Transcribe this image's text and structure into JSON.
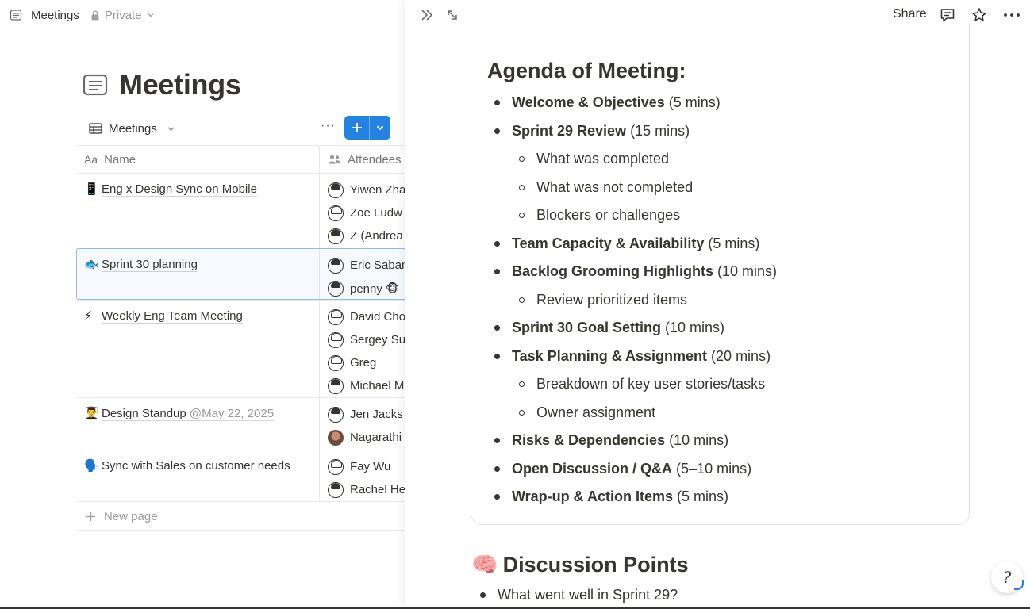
{
  "breadcrumb": {
    "page": "Meetings",
    "privacy": "Private"
  },
  "page": {
    "title": "Meetings"
  },
  "view": {
    "name": "Meetings"
  },
  "table": {
    "columns": [
      "Name",
      "Attendees"
    ],
    "column_icons": [
      "Aa",
      "people-icon"
    ],
    "rows": [
      {
        "emoji": "📱",
        "title": "Eng x Design Sync on Mobile",
        "date": "",
        "attendees": [
          "Yiwen Zha",
          "Zoe Ludw",
          "Z (Andrea"
        ]
      },
      {
        "emoji": "🐟",
        "title": "Sprint 30 planning",
        "date": "",
        "attendees": [
          "Eric Saban",
          "penny 🐵"
        ]
      },
      {
        "emoji": "⚡",
        "title": "Weekly Eng Team Meeting",
        "date": "",
        "attendees": [
          "David Cho",
          "Sergey Su",
          "Greg",
          "Michael M"
        ]
      },
      {
        "emoji": "👨‍🎓",
        "title": "Design Standup",
        "date": "@May 22, 2025",
        "attendees": [
          "Jen Jacks",
          "Nagarathi"
        ]
      },
      {
        "emoji": "🗣️",
        "title": "Sync with Sales on customer needs",
        "date": "",
        "attendees": [
          "Fay Wu",
          "Rachel He"
        ]
      }
    ],
    "new_page_label": "New page"
  },
  "peek": {
    "share_label": "Share",
    "agenda_heading": "Agenda of Meeting:",
    "agenda": [
      {
        "level": 1,
        "bold": "Welcome & Objectives",
        "rest": "(5 mins)"
      },
      {
        "level": 1,
        "bold": "Sprint 29 Review",
        "rest": "(15 mins)"
      },
      {
        "level": 2,
        "bold": "",
        "rest": "What was completed"
      },
      {
        "level": 2,
        "bold": "",
        "rest": "What was not completed"
      },
      {
        "level": 2,
        "bold": "",
        "rest": "Blockers or challenges"
      },
      {
        "level": 1,
        "bold": "Team Capacity & Availability",
        "rest": "(5 mins)"
      },
      {
        "level": 1,
        "bold": "Backlog Grooming Highlights",
        "rest": "(10 mins)"
      },
      {
        "level": 2,
        "bold": "",
        "rest": "Review prioritized items"
      },
      {
        "level": 1,
        "bold": "Sprint 30 Goal Setting",
        "rest": "(10 mins)"
      },
      {
        "level": 1,
        "bold": "Task Planning & Assignment",
        "rest": "(20 mins)"
      },
      {
        "level": 2,
        "bold": "",
        "rest": "Breakdown of key user stories/tasks"
      },
      {
        "level": 2,
        "bold": "",
        "rest": "Owner assignment"
      },
      {
        "level": 1,
        "bold": "Risks & Dependencies",
        "rest": "(10 mins)"
      },
      {
        "level": 1,
        "bold": "Open Discussion / Q&A",
        "rest": "(5–10 mins)"
      },
      {
        "level": 1,
        "bold": "Wrap-up & Action Items",
        "rest": "(5 mins)"
      }
    ],
    "discussion_emoji": "🧠",
    "discussion_heading": "Discussion Points",
    "discussion_first_item": "What went well in Sprint 29?"
  },
  "colors": {
    "accent": "#2383e2",
    "text": "#37352f",
    "muted": "#9b9a97",
    "border": "#e9e9e7"
  }
}
